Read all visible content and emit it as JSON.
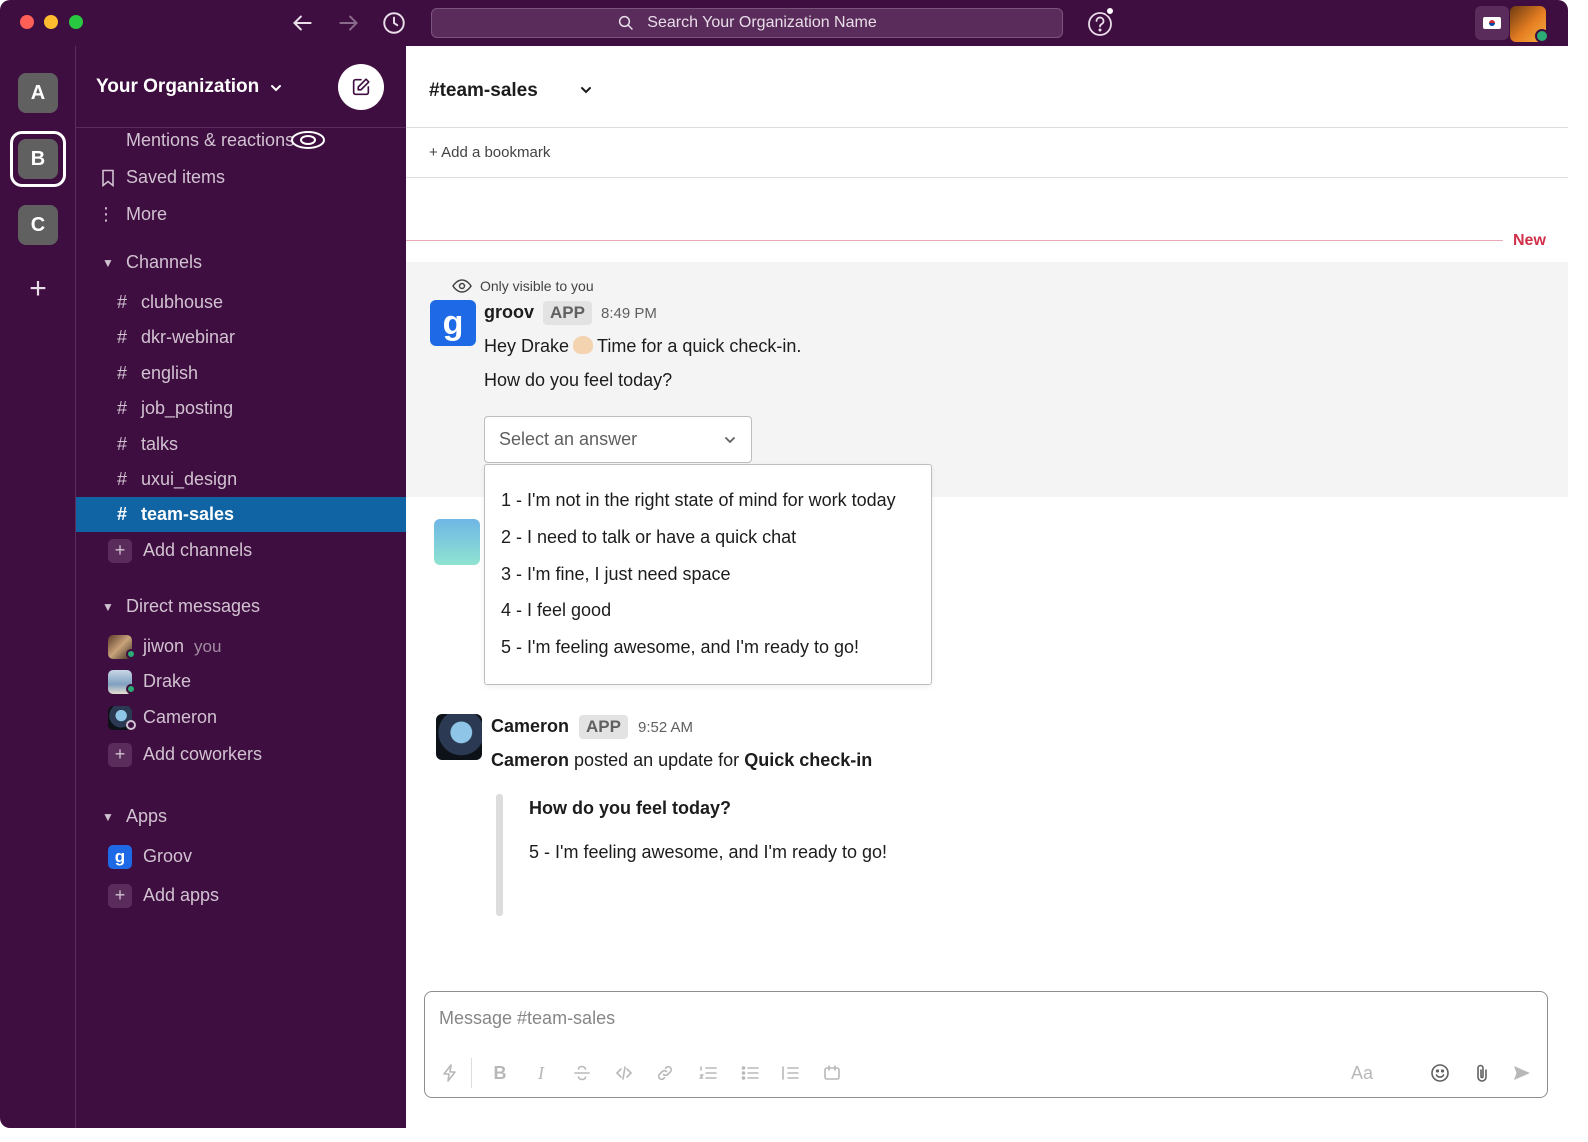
{
  "search": {
    "placeholder": "Search Your Organization Name"
  },
  "workspaces": [
    "A",
    "B",
    "C"
  ],
  "sidebar": {
    "org_name": "Your Organization",
    "top_items": [
      {
        "label": "Mentions & reactions"
      },
      {
        "label": "Saved items"
      },
      {
        "label": "More"
      }
    ],
    "channels_header": "Channels",
    "channels": [
      "clubhouse",
      "dkr-webinar",
      "english",
      "job_posting",
      "talks",
      "uxui_design",
      "team-sales"
    ],
    "active_channel": "team-sales",
    "add_channels": "Add channels",
    "dm_header": "Direct messages",
    "dms": [
      {
        "name": "jiwon",
        "tag": "you"
      },
      {
        "name": "Drake"
      },
      {
        "name": "Cameron"
      }
    ],
    "add_coworkers": "Add coworkers",
    "apps_header": "Apps",
    "apps": [
      "Groov"
    ],
    "add_apps": "Add apps"
  },
  "channel": {
    "title": "#team-sales",
    "add_bookmark": "+ Add a bookmark",
    "new_label": "New"
  },
  "messages": {
    "ephemeral_note": "Only visible to you",
    "groov": {
      "sender": "groov",
      "badge": "APP",
      "time": "8:49 PM",
      "greeting_pre": "Hey Drake",
      "greeting_post": "Time for a quick check-in.",
      "question": "How do you feel today?",
      "select_placeholder": "Select an answer",
      "options": [
        "1 -  I'm not in the right state of mind for work today",
        "2 - I need to talk or have a quick chat",
        "3 - I'm fine, I just need space",
        "4 - I feel good",
        "5 - I'm feeling awesome, and I'm ready to go!"
      ]
    },
    "cameron": {
      "sender": "Cameron",
      "badge": "APP",
      "time": "9:52 AM",
      "line_name": "Cameron",
      "line_mid": "posted an update for",
      "line_bold": "Quick check-in",
      "quote_question": "How do you feel today?",
      "quote_answer": "5 - I'm feeling awesome, and I'm ready to go!"
    }
  },
  "composer": {
    "placeholder": "Message #team-sales",
    "font_label": "Aa",
    "bold": "B",
    "italic": "I"
  },
  "colors": {
    "aubergine": "#3f0e40",
    "active": "#1164a3",
    "new_red": "#d1304b",
    "groov_blue": "#1e6ae6"
  }
}
